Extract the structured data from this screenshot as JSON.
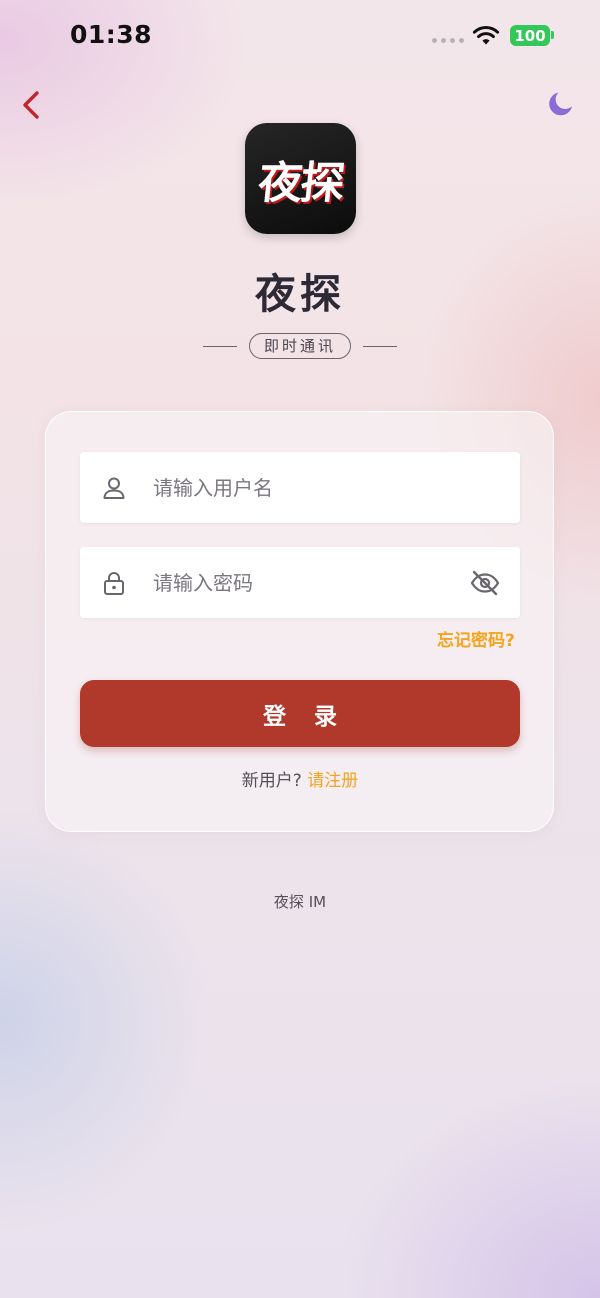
{
  "status_bar": {
    "time": "01:38",
    "battery": "100"
  },
  "colors": {
    "accent": "#b0392c",
    "link": "#f2a51d",
    "back_arrow": "#c0262d",
    "moon": "#8b6cd6"
  },
  "nav": {
    "back_icon": "chevron-left-icon",
    "theme_icon": "moon-icon"
  },
  "brand": {
    "logo_text": "夜探",
    "app_name": "夜探",
    "tagline": "即时通讯"
  },
  "form": {
    "username_placeholder": "请输入用户名",
    "username_value": "",
    "password_placeholder": "请输入密码",
    "password_value": "",
    "forgot_password": "忘记密码?",
    "login_button": "登录",
    "new_user_prompt": "新用户?",
    "register_link": "请注册"
  },
  "footer": {
    "text": "夜探 IM"
  }
}
